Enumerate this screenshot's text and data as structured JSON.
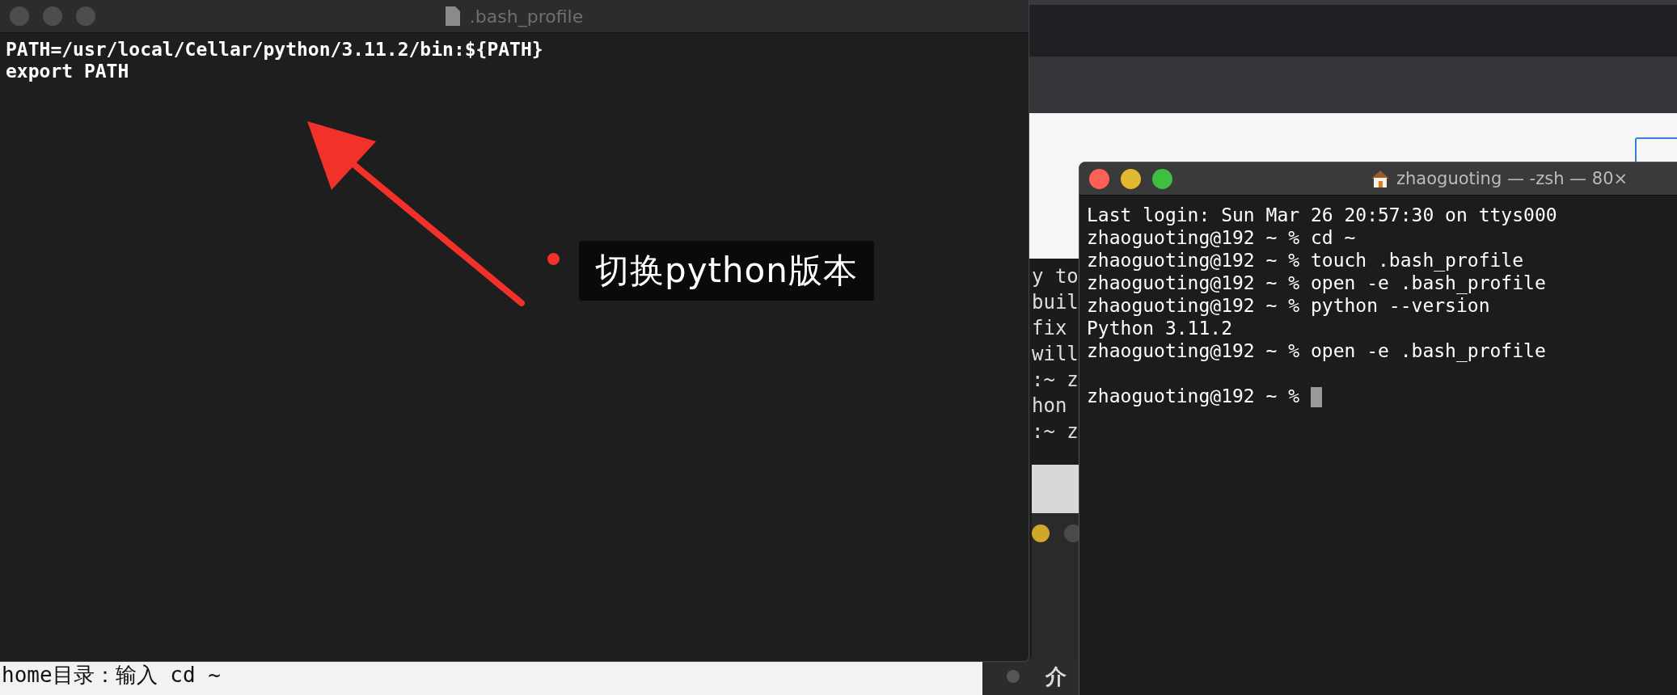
{
  "editor": {
    "title": ".bash_profile",
    "lines": [
      "PATH=/usr/local/Cellar/python/3.11.2/bin:${PATH}",
      "export PATH"
    ]
  },
  "annotation": {
    "text": "切换python版本"
  },
  "background_terminal": {
    "lines": [
      "y to",
      "buil",
      "fix",
      "will",
      ":~ z",
      "hon",
      ":~ z"
    ]
  },
  "terminal": {
    "title": "zhaoguoting — -zsh — 80×",
    "lines": [
      "Last login: Sun Mar 26 20:57:30 on ttys000",
      "zhaoguoting@192 ~ % cd ~",
      "zhaoguoting@192 ~ % touch .bash_profile",
      "zhaoguoting@192 ~ % open -e .bash_profile",
      "zhaoguoting@192 ~ % python --version",
      "Python 3.11.2",
      "zhaoguoting@192 ~ % open -e .bash_profile",
      "zhaoguoting@192 ~ % "
    ]
  },
  "caption": {
    "text": "home目录：输入 cd ~"
  },
  "background_panel": {
    "label": "介"
  }
}
